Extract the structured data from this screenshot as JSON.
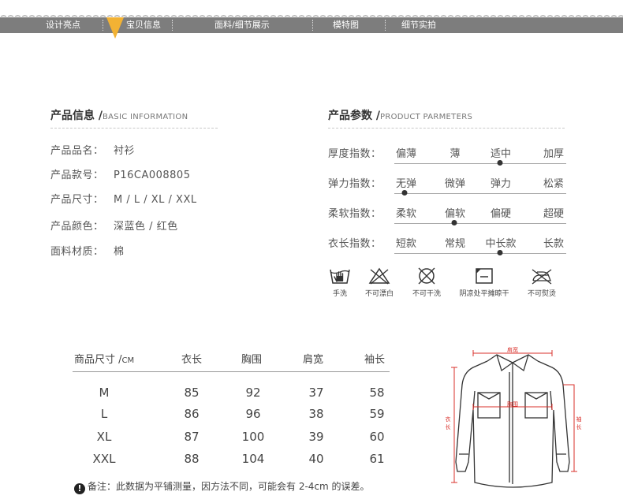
{
  "nav": {
    "items": [
      "设计亮点",
      "宝贝信息",
      "面料/细节展示",
      "模特图",
      "细节实拍"
    ],
    "bar_color": "#7d7d7d",
    "marker_color": "#f2b234"
  },
  "basic_info": {
    "title_zh": "产品信息 /",
    "title_en": "BASIC INFORMATION",
    "rows": [
      {
        "label": "产品品名：",
        "value": "衬衫"
      },
      {
        "label": "产品款号：",
        "value": "P16CA008805"
      },
      {
        "label": "产品尺寸：",
        "value": "M / L / XL / XXL"
      },
      {
        "label": "产品颜色：",
        "value": "深蓝色 / 红色"
      },
      {
        "label": "面料材质：",
        "value": "棉"
      }
    ]
  },
  "params": {
    "title_zh": "产品参数 /",
    "title_en": "PRODUCT PARMETERS",
    "rows": [
      {
        "label": "厚度指数：",
        "options": [
          "偏薄",
          "薄",
          "适中",
          "加厚"
        ],
        "selected": 2
      },
      {
        "label": "弹力指数：",
        "options": [
          "无弹",
          "微弹",
          "弹力",
          "松紧"
        ],
        "selected": 0
      },
      {
        "label": "柔软指数：",
        "options": [
          "柔软",
          "偏软",
          "偏硬",
          "超硬"
        ],
        "selected": 1
      },
      {
        "label": "衣长指数：",
        "options": [
          "短款",
          "常规",
          "中长款",
          "长款"
        ],
        "selected": 2
      }
    ]
  },
  "care": {
    "items": [
      {
        "label": "手洗",
        "icon": "hand-wash-icon"
      },
      {
        "label": "不可漂白",
        "icon": "no-bleach-icon"
      },
      {
        "label": "不可干洗",
        "icon": "no-dry-clean-icon"
      },
      {
        "label": "阴凉处平摊晾干",
        "icon": "dry-flat-shade-icon"
      },
      {
        "label": "不可熨烫",
        "icon": "no-iron-icon"
      }
    ]
  },
  "size_table": {
    "header_first": "商品尺寸 /",
    "header_unit": "CM",
    "columns": [
      "衣长",
      "胸围",
      "肩宽",
      "袖长"
    ],
    "rows": [
      {
        "size": "M",
        "values": [
          "85",
          "92",
          "37",
          "58"
        ]
      },
      {
        "size": "L",
        "values": [
          "86",
          "96",
          "38",
          "59"
        ]
      },
      {
        "size": "XL",
        "values": [
          "87",
          "100",
          "39",
          "60"
        ]
      },
      {
        "size": "XXL",
        "values": [
          "88",
          "104",
          "40",
          "61"
        ]
      }
    ]
  },
  "note": {
    "icon": "!",
    "text": "备注：此数据为平铺测量，因方法不同，可能会有 2-4cm 的误差。"
  },
  "diagram": {
    "shoulder_label": "肩宽",
    "chest_label": "胸围",
    "length_label_1": "衣",
    "length_label_2": "长",
    "sleeve_label_1": "袖",
    "sleeve_label_2": "长",
    "measure_color": "#d9302b"
  }
}
